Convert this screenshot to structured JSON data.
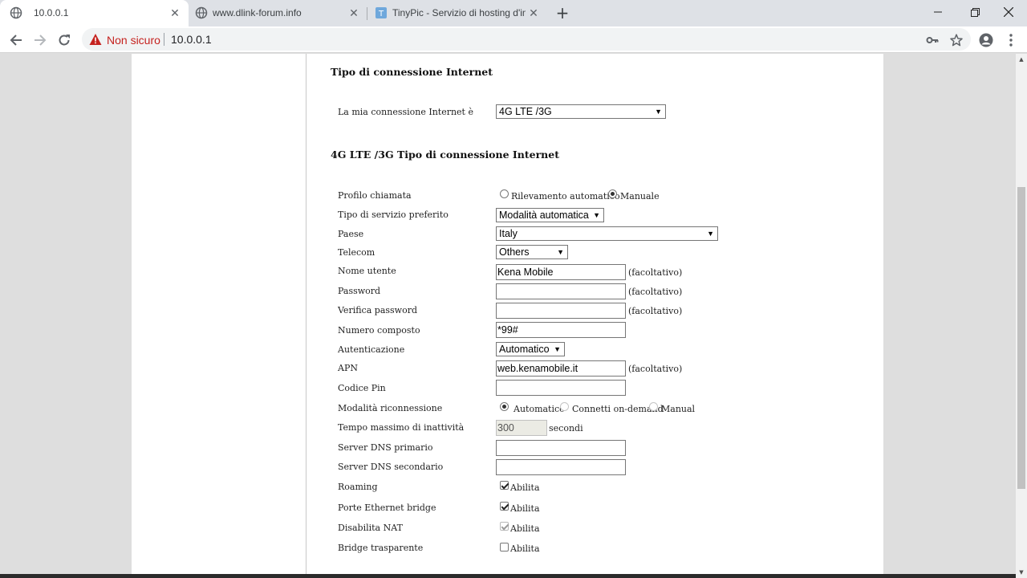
{
  "browser": {
    "tabs": [
      {
        "title": "10.0.0.1",
        "icon": "globe-icon",
        "active": true
      },
      {
        "title": "www.dlink-forum.info",
        "icon": "globe-icon",
        "active": false
      },
      {
        "title": "TinyPic - Servizio di hosting d'imm",
        "icon": "tinypic-icon",
        "active": false
      }
    ],
    "security_label": "Non sicuro",
    "url": "10.0.0.1"
  },
  "page": {
    "section1_title": "Tipo di connessione Internet",
    "connection": {
      "label": "La mia connessione Internet è",
      "value": "4G LTE /3G"
    },
    "section2_title": "4G LTE /3G Tipo di connessione Internet",
    "fields": {
      "profilo": {
        "label": "Profilo chiamata",
        "options": [
          "Rilevamento automatico",
          "Manuale"
        ],
        "selected": "Manuale"
      },
      "servizio": {
        "label": "Tipo di servizio preferito",
        "value": "Modalità automatica"
      },
      "paese": {
        "label": "Paese",
        "value": "Italy"
      },
      "telecom": {
        "label": "Telecom",
        "value": "Others"
      },
      "nome_utente": {
        "label": "Nome utente",
        "value": "Kena Mobile",
        "hint": "(facoltativo)"
      },
      "password": {
        "label": "Password",
        "value": "",
        "hint": "(facoltativo)"
      },
      "verifica_password": {
        "label": "Verifica password",
        "value": "",
        "hint": "(facoltativo)"
      },
      "numero_composto": {
        "label": "Numero composto",
        "value": "*99#"
      },
      "autenticazione": {
        "label": "Autenticazione",
        "value": "Automatico"
      },
      "apn": {
        "label": "APN",
        "value": "web.kenamobile.it",
        "hint": "(facoltativo)"
      },
      "codice_pin": {
        "label": "Codice Pin",
        "value": ""
      },
      "riconnessione": {
        "label": "Modalità riconnessione",
        "options": [
          "Automatico",
          "Connetti on-demand",
          "Manual"
        ],
        "selected": "Automatico"
      },
      "tempo_inattivita": {
        "label": "Tempo massimo di inattività",
        "value": "300",
        "unit": "secondi"
      },
      "dns_primario": {
        "label": "Server DNS primario",
        "value": ""
      },
      "dns_secondario": {
        "label": "Server DNS secondario",
        "value": ""
      },
      "roaming": {
        "label": "Roaming",
        "option": "Abilita",
        "checked": true
      },
      "porte_ethernet": {
        "label": "Porte Ethernet bridge",
        "option": "Abilita",
        "checked": true
      },
      "disabilita_nat": {
        "label": "Disabilita NAT",
        "option": "Abilita",
        "checked": true,
        "disabled": true
      },
      "bridge_trasparente": {
        "label": "Bridge trasparente",
        "option": "Abilita",
        "checked": false
      }
    }
  },
  "colors": {
    "warning": "#c5221f",
    "chrome_bg": "#dee1e6",
    "page_bg": "#dedede"
  }
}
